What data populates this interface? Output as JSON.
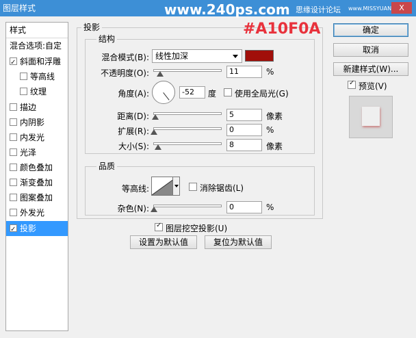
{
  "window": {
    "title": "图层样式",
    "watermark": "www.240ps.com",
    "site_cn": "思缘设计论坛",
    "site_en": "www.MISSYUAN.COM",
    "close_label": "X"
  },
  "annotation": {
    "color_code": "#A10F0A"
  },
  "left_panel": {
    "header": "样式",
    "blend_options": "混合选项:自定",
    "items": [
      {
        "label": "斜面和浮雕",
        "checked": true
      },
      {
        "label": "等高线",
        "checked": false
      },
      {
        "label": "纹理",
        "checked": false
      },
      {
        "label": "描边",
        "checked": false
      },
      {
        "label": "内阴影",
        "checked": false
      },
      {
        "label": "内发光",
        "checked": false
      },
      {
        "label": "光泽",
        "checked": false
      },
      {
        "label": "颜色叠加",
        "checked": false
      },
      {
        "label": "渐变叠加",
        "checked": false
      },
      {
        "label": "图案叠加",
        "checked": false
      },
      {
        "label": "外发光",
        "checked": false
      },
      {
        "label": "投影",
        "checked": true,
        "selected": true
      }
    ]
  },
  "drop_shadow": {
    "section_title": "投影",
    "structure": {
      "title": "结构",
      "blend_mode_label": "混合模式(B):",
      "blend_mode_value": "线性加深",
      "color": "#A10F0A",
      "opacity_label": "不透明度(O):",
      "opacity_value": "11",
      "opacity_unit": "%",
      "angle_label": "角度(A):",
      "angle_value": "-52",
      "angle_unit": "度",
      "global_light_label": "使用全局光(G)",
      "global_light_checked": false,
      "distance_label": "距离(D):",
      "distance_value": "5",
      "distance_unit": "像素",
      "spread_label": "扩展(R):",
      "spread_value": "0",
      "spread_unit": "%",
      "size_label": "大小(S):",
      "size_value": "8",
      "size_unit": "像素"
    },
    "quality": {
      "title": "品质",
      "contour_label": "等高线:",
      "anti_alias_label": "消除锯齿(L)",
      "anti_alias_checked": false,
      "noise_label": "杂色(N):",
      "noise_value": "0",
      "noise_unit": "%"
    },
    "knockout_label": "图层挖空投影(U)",
    "knockout_checked": true,
    "make_default_label": "设置为默认值",
    "reset_default_label": "复位为默认值"
  },
  "right_panel": {
    "ok_label": "确定",
    "cancel_label": "取消",
    "new_style_label": "新建样式(W)...",
    "preview_label": "预览(V)",
    "preview_checked": true
  }
}
